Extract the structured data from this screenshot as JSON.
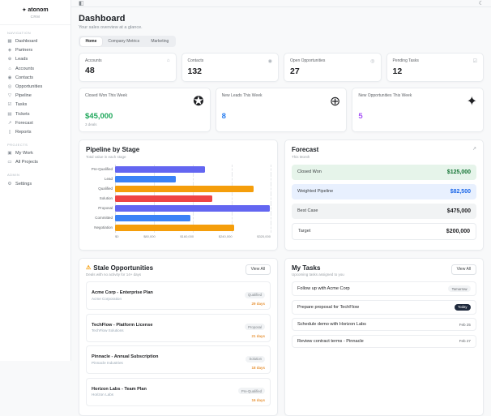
{
  "icons": {
    "logo-icon": "✦",
    "panel-toggle-icon": "◧",
    "theme-toggle-icon": "☾",
    "dashboard-icon": "▦",
    "partners-icon": "◈",
    "leads-icon": "⊕",
    "accounts-icon": "⌂",
    "contacts-icon": "◉",
    "opportunities-icon": "◎",
    "pipeline-icon": "▽",
    "tasks-icon": "☑",
    "tickets-icon": "▤",
    "forecast-icon": "↗",
    "reports-icon": "▯",
    "my-work-icon": "▣",
    "all-projects-icon": "▭",
    "settings-icon": "⚙",
    "building-icon": "⌂",
    "users-icon": "◉",
    "target-icon": "◎",
    "check-icon": "☑",
    "trophy-icon": "✪",
    "user-plus-icon": "⊕",
    "sparkle-icon": "✦",
    "warning-icon": "⚠",
    "trend-up-icon": "↗"
  },
  "sidebar": {
    "logo": {
      "name": "atonom",
      "sub": "CRM",
      "icon": "logo-icon"
    },
    "sections": [
      {
        "label": "Navigation",
        "items": [
          {
            "label": "Dashboard",
            "icon": "dashboard-icon"
          },
          {
            "label": "Partners",
            "icon": "partners-icon"
          },
          {
            "label": "Leads",
            "icon": "leads-icon"
          },
          {
            "label": "Accounts",
            "icon": "accounts-icon"
          },
          {
            "label": "Contacts",
            "icon": "contacts-icon"
          },
          {
            "label": "Opportunities",
            "icon": "opportunities-icon"
          },
          {
            "label": "Pipeline",
            "icon": "pipeline-icon"
          },
          {
            "label": "Tasks",
            "icon": "tasks-icon"
          },
          {
            "label": "Tickets",
            "icon": "tickets-icon"
          },
          {
            "label": "Forecast",
            "icon": "forecast-icon"
          },
          {
            "label": "Reports",
            "icon": "reports-icon"
          }
        ]
      },
      {
        "label": "Projects",
        "items": [
          {
            "label": "My Work",
            "icon": "my-work-icon"
          },
          {
            "label": "All Projects",
            "icon": "all-projects-icon"
          }
        ]
      },
      {
        "label": "Admin",
        "items": [
          {
            "label": "Settings",
            "icon": "settings-icon"
          }
        ]
      }
    ]
  },
  "header": {
    "title": "Dashboard",
    "subtitle": "Your sales overview at a glance.",
    "tabs": [
      {
        "label": "Home",
        "state": "active"
      },
      {
        "label": "Company Metrics",
        "state": "inactive"
      },
      {
        "label": "Marketing",
        "state": "inactive"
      }
    ]
  },
  "stats": [
    {
      "label": "Accounts",
      "value": "48",
      "icon": "building-icon"
    },
    {
      "label": "Contacts",
      "value": "132",
      "icon": "users-icon"
    },
    {
      "label": "Open Opportunities",
      "value": "27",
      "icon": "target-icon"
    },
    {
      "label": "Pending Tasks",
      "value": "12",
      "icon": "check-icon"
    }
  ],
  "weekly": [
    {
      "label": "Closed Won This Week",
      "value": "$45,000",
      "sub": "3 deals",
      "color": "#1ea75a",
      "icon": "trophy-icon"
    },
    {
      "label": "New Leads This Week",
      "value": "8",
      "sub": "",
      "color": "#2b7ff0",
      "icon": "user-plus-icon"
    },
    {
      "label": "New Opportunities This Week",
      "value": "5",
      "sub": "",
      "color": "#a855f7",
      "icon": "sparkle-icon"
    }
  ],
  "chart_data": {
    "type": "bar",
    "orientation": "horizontal",
    "title": "Pipeline by Stage",
    "subtitle": "Total value in each stage",
    "categories": [
      "Pre-Qualified",
      "Lead",
      "Qualified",
      "Solution",
      "Proposal",
      "Committed",
      "Negotiation"
    ],
    "values": [
      185000,
      125000,
      285000,
      200000,
      318000,
      155000,
      245000
    ],
    "colors": [
      "#6366f1",
      "#3b82f6",
      "#f59e0b",
      "#ef4444",
      "#6366f1",
      "#3b82f6",
      "#f59e0b"
    ],
    "xlim": [
      0,
      320000
    ],
    "xticks": [
      "$0",
      "$80,000",
      "$160,000",
      "$240,000",
      "$320,000"
    ],
    "grid": true,
    "legend": false
  },
  "forecast": {
    "title": "Forecast",
    "subtitle": "This Month",
    "icon": "trend-up-icon",
    "rows": [
      {
        "label": "Closed Won",
        "value": "$125,000",
        "style": "fc-green"
      },
      {
        "label": "Weighted Pipeline",
        "value": "$82,500",
        "style": "fc-blue"
      },
      {
        "label": "Best Case",
        "value": "$475,000",
        "style": "fc-gray"
      },
      {
        "label": "Target",
        "value": "$200,000",
        "style": "fc-white"
      }
    ]
  },
  "stale": {
    "title": "Stale Opportunities",
    "icon": "warning-icon",
    "subtitle": "Deals with no activity for 14+ days",
    "view_all": "View All",
    "items": [
      {
        "title": "Acme Corp - Enterprise Plan",
        "company": "Acme Corporation",
        "stage": "Qualified",
        "days": "29 days"
      },
      {
        "title": "TechFlow - Platform License",
        "company": "TechFlow Solutions",
        "stage": "Proposal",
        "days": "21 days"
      },
      {
        "title": "Pinnacle - Annual Subscription",
        "company": "Pinnacle Industries",
        "stage": "Solution",
        "days": "18 days"
      },
      {
        "title": "Horizon Labs - Team Plan",
        "company": "Horizon Labs",
        "stage": "Pre-Qualified",
        "days": "16 days"
      }
    ]
  },
  "tasks": {
    "title": "My Tasks",
    "subtitle": "Upcoming tasks assigned to you",
    "view_all": "View All",
    "items": [
      {
        "title": "Follow up with Acme Corp",
        "due": "Tomorrow",
        "style": "due-badge-light"
      },
      {
        "title": "Prepare proposal for TechFlow",
        "due": "Today",
        "style": "due-badge-dark"
      },
      {
        "title": "Schedule demo with Horizon Labs",
        "due": "Feb 25",
        "style": "due-plain"
      },
      {
        "title": "Review contract terms - Pinnacle",
        "due": "Feb 27",
        "style": "due-plain"
      }
    ]
  }
}
